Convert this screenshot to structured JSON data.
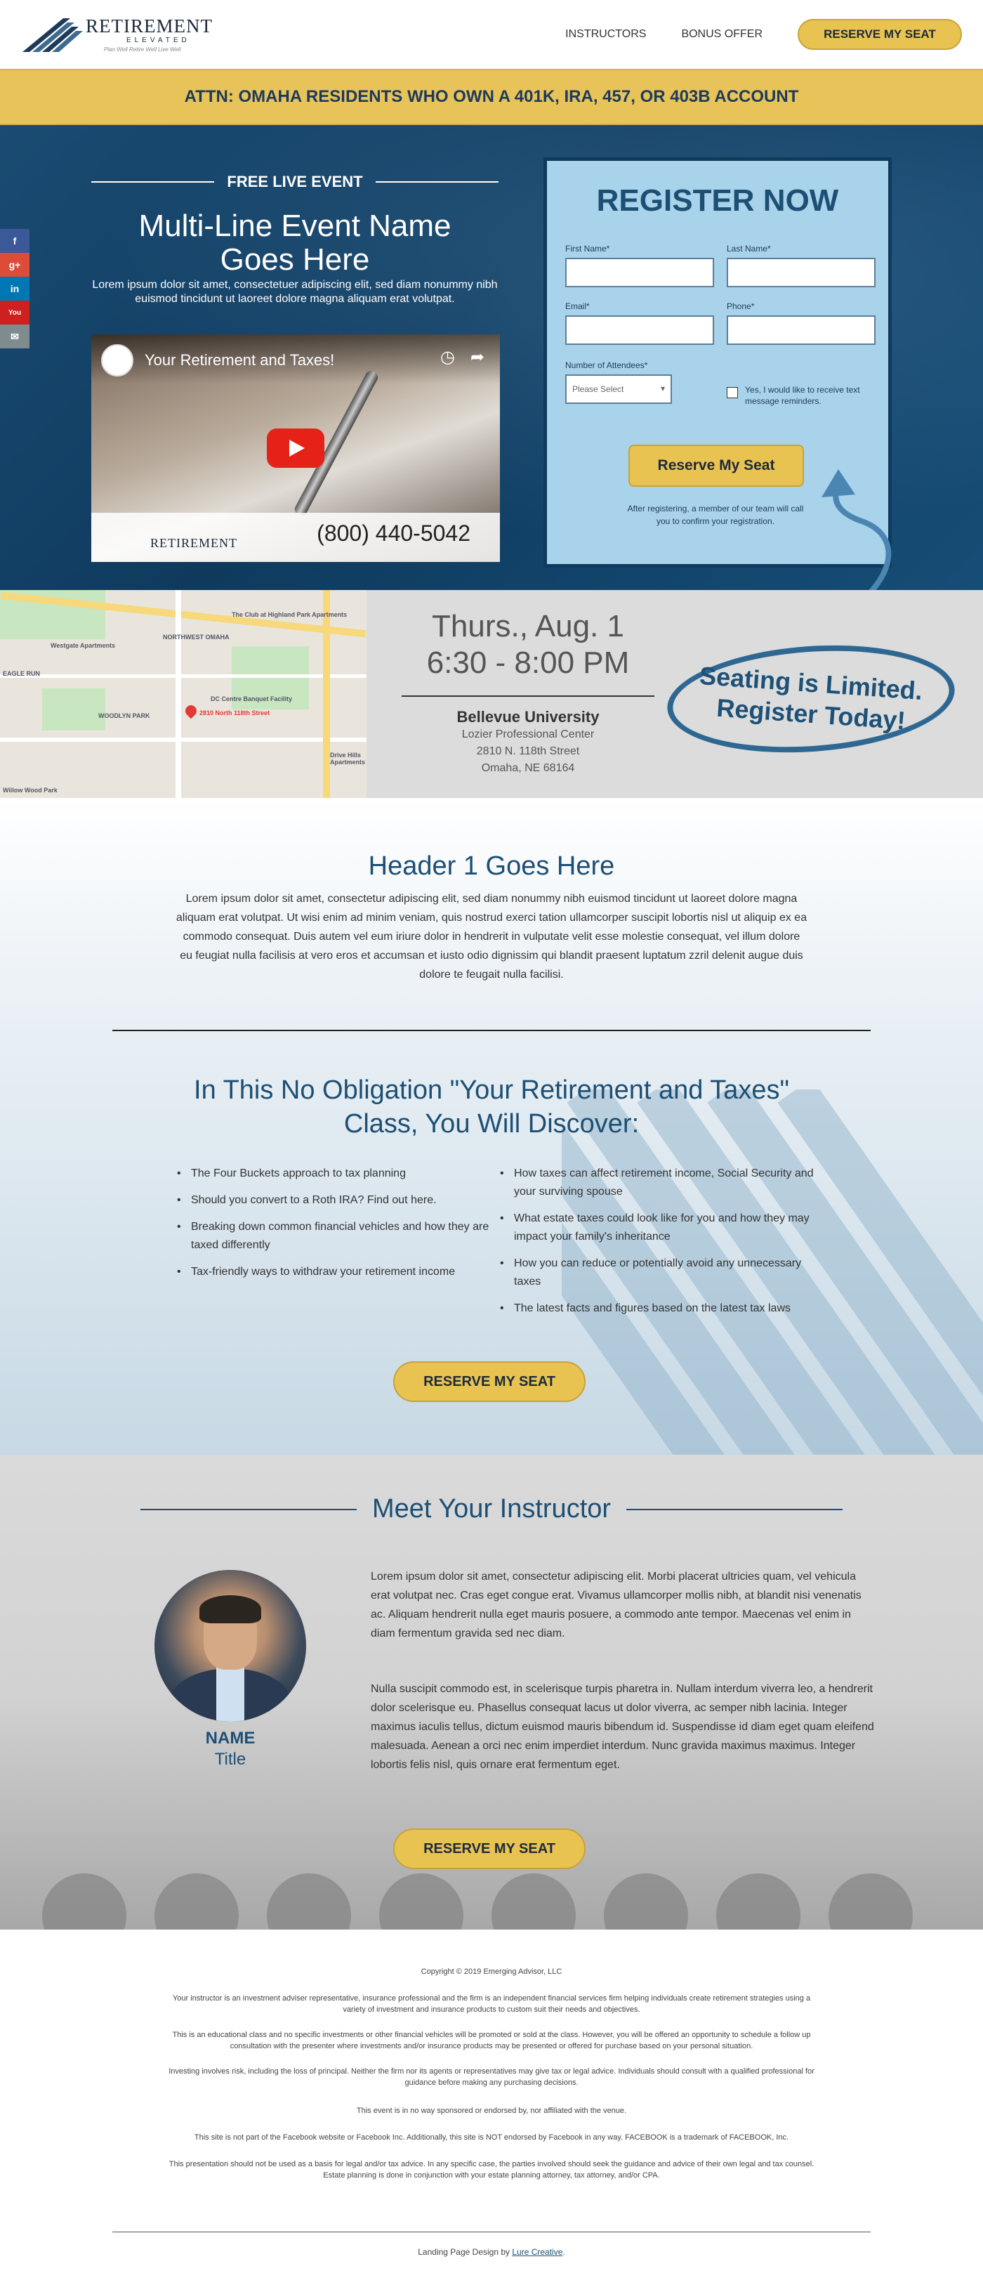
{
  "header": {
    "logo_name": "RETIREMENT",
    "logo_sub": "ELEVATED",
    "logo_tagline": "Plan Well Retire Well Live Well",
    "nav": [
      "INSTRUCTORS",
      "BONUS OFFER"
    ],
    "cta": "RESERVE MY SEAT"
  },
  "attn_bar": "ATTN: OMAHA RESIDENTS WHO OWN A 401K, IRA, 457, OR 403B ACCOUNT",
  "social": [
    {
      "icon": "facebook-icon",
      "label": "f",
      "color": "#3b5998"
    },
    {
      "icon": "google-plus-icon",
      "label": "g+",
      "color": "#dd4b39"
    },
    {
      "icon": "linkedin-icon",
      "label": "in",
      "color": "#0077b5"
    },
    {
      "icon": "youtube-icon",
      "label": "You",
      "color": "#cd201f"
    },
    {
      "icon": "email-icon",
      "label": "✉",
      "color": "#7f8c8d"
    }
  ],
  "hero": {
    "kicker": "FREE LIVE EVENT",
    "title_line1": "Multi-Line Event Name",
    "title_line2": "Goes Here",
    "description": "Lorem ipsum dolor sit amet, consectetuer adipiscing elit, sed diam nonummy nibh euismod tincidunt ut laoreet dolore magna aliquam erat volutpat.",
    "video": {
      "title": "Your Retirement and Taxes!",
      "phone": "(800) 440-5042",
      "logo": "RETIREMENT"
    }
  },
  "register": {
    "heading": "REGISTER NOW",
    "first_name_label": "First Name*",
    "last_name_label": "Last Name*",
    "email_label": "Email*",
    "phone_label": "Phone*",
    "attendees_label": "Number of Attendees*",
    "attendees_placeholder": "Please Select",
    "sms_label": "Yes, I would like to receive text message reminders.",
    "submit": "Reserve My Seat",
    "after_note": "After registering, a member of our team will call you to confirm your registration."
  },
  "event_info": {
    "date": "Thurs., Aug. 1",
    "time": "6:30 - 8:00 PM",
    "venue": "Bellevue University",
    "building": "Lozier Professional Center",
    "street": "2810 N. 118th Street",
    "city": "Omaha, NE 68164",
    "limited_line1": "Seating is Limited.",
    "limited_line2": "Register Today!",
    "map_labels": [
      "NORTHWEST OMAHA",
      "WOODLYN PARK",
      "EAGLE RUN",
      "Westgate Apartments",
      "The Club at Highland Park Apartments",
      "DC Centre Banquet Facility",
      "2810 North 118th Street",
      "Willow Wood Park",
      "Drive Hills Apartments"
    ]
  },
  "content": {
    "header1": "Header 1 Goes Here",
    "paragraph": "Lorem ipsum dolor sit amet, consectetur adipiscing elit, sed diam nonummy nibh euismod tincidunt ut laoreet dolore magna aliquam erat volutpat. Ut wisi enim ad minim veniam, quis nostrud exerci tation ullamcorper suscipit lobortis nisl ut aliquip ex ea commodo consequat. Duis autem vel eum iriure dolor in hendrerit in vulputate velit esse molestie consequat, vel illum dolore eu feugiat nulla facilisis at vero eros et accumsan et iusto odio dignissim qui blandit praesent luptatum zzril delenit augue duis dolore te feugait nulla facilisi.",
    "discover_line1": "In This No Obligation \"Your Retirement and Taxes\"",
    "discover_line2": "Class, You Will Discover:",
    "list_left": [
      "The Four Buckets approach to tax planning",
      "Should you convert to a Roth IRA? Find out here.",
      "Breaking down common financial vehicles and how they are taxed differently",
      "Tax-friendly ways to withdraw your retirement income"
    ],
    "list_right": [
      "How taxes can affect retirement income, Social Security and your surviving spouse",
      "What estate taxes could look like for you and how they may impact your family's inheritance",
      "How you can reduce or potentially avoid any unnecessary taxes",
      "The latest facts and figures based on the latest tax laws"
    ],
    "cta": "RESERVE MY SEAT"
  },
  "instructor": {
    "heading": "Meet Your Instructor",
    "name": "NAME",
    "title": "Title",
    "bio1": "Lorem ipsum dolor sit amet, consectetur adipiscing elit. Morbi placerat ultricies quam, vel vehicula erat volutpat nec. Cras eget congue erat. Vivamus ullamcorper mollis nibh, at blandit nisi venenatis ac. Aliquam hendrerit nulla eget mauris posuere, a commodo ante tempor. Maecenas vel enim in diam fermentum gravida sed nec diam.",
    "bio2": "Nulla suscipit commodo est, in scelerisque turpis pharetra in. Nullam interdum viverra leo, a hendrerit dolor scelerisque eu. Phasellus consequat lacus ut dolor viverra, ac semper nibh lacinia. Integer maximus iaculis tellus, dictum euismod mauris bibendum id. Suspendisse id diam eget quam eleifend malesuada. Aenean a orci nec enim imperdiet interdum. Nunc gravida maximus maximus. Integer lobortis felis nisl, quis ornare erat fermentum eget.",
    "cta": "RESERVE MY SEAT"
  },
  "footer": {
    "copyright": "Copyright © 2019 Emerging Advisor, LLC",
    "notes": [
      "Your instructor is an investment adviser representative, insurance professional and the firm is an independent financial services firm helping individuals create retirement strategies using a variety of investment and insurance products to custom suit their needs and objectives.",
      "This is an educational class and no specific investments or other financial vehicles will be promoted or sold at the class. However, you will be offered an opportunity to schedule a follow up consultation with the presenter where investments and/or insurance products may be presented or offered for purchase based on your personal situation.",
      "Investing involves risk, including the loss of principal. Neither the firm nor its agents or representatives may give tax or legal advice. Individuals should consult with a qualified professional for guidance before making any purchasing decisions.",
      "This event is in no way sponsored or endorsed by, nor affiliated with the venue.",
      "This site is not part of the Facebook website or Facebook Inc. Additionally, this site is NOT endorsed by Facebook in any way. FACEBOOK is a trademark of FACEBOOK, Inc.",
      "This presentation should not be used as a basis for legal and/or tax advice. In any specific case, the parties involved should seek the guidance and advice of their own legal and tax counsel. Estate planning is done in conjunction with your estate planning attorney, tax attorney, and/or CPA."
    ],
    "credit_prefix": "Landing Page Design by ",
    "credit_link": "Lure Creative",
    "credit_suffix": "."
  }
}
